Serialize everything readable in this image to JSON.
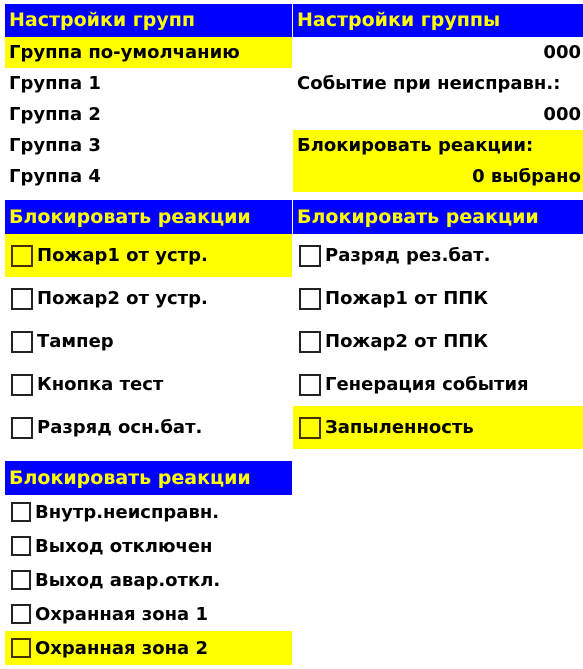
{
  "panels": {
    "group_settings": {
      "title": "Настройки групп",
      "items": [
        {
          "label": "Группа по-умолчанию",
          "selected": true
        },
        {
          "label": "Группа 1",
          "selected": false
        },
        {
          "label": "Группа 2",
          "selected": false
        },
        {
          "label": "Группа 3",
          "selected": false
        },
        {
          "label": "Группа 4",
          "selected": false
        }
      ]
    },
    "group_config": {
      "title": "Настройки группы",
      "rows": [
        {
          "text": "000",
          "align": "right",
          "selected": false
        },
        {
          "text": "Событие при неисправн.:",
          "align": "left",
          "selected": false
        },
        {
          "text": "000",
          "align": "right",
          "selected": false
        },
        {
          "text": "Блокировать реакции:",
          "align": "left",
          "selected": true
        },
        {
          "text": "0 выбрано",
          "align": "right",
          "selected": true
        }
      ]
    },
    "block_reactions_1": {
      "title": "Блокировать реакции",
      "items": [
        {
          "label": "Пожар1 от устр.",
          "checked": false,
          "selected": true
        },
        {
          "label": "Пожар2 от устр.",
          "checked": false,
          "selected": false
        },
        {
          "label": "Тампер",
          "checked": false,
          "selected": false
        },
        {
          "label": "Кнопка тест",
          "checked": false,
          "selected": false
        },
        {
          "label": "Разряд осн.бат.",
          "checked": false,
          "selected": false
        }
      ]
    },
    "block_reactions_2": {
      "title": "Блокировать реакции",
      "items": [
        {
          "label": "Разряд рез.бат.",
          "checked": false,
          "selected": false
        },
        {
          "label": "Пожар1 от ППК",
          "checked": false,
          "selected": false
        },
        {
          "label": "Пожар2 от ППК",
          "checked": false,
          "selected": false
        },
        {
          "label": "Генерация события",
          "checked": false,
          "selected": false
        },
        {
          "label": "Запыленность",
          "checked": false,
          "selected": true
        }
      ]
    },
    "block_reactions_3": {
      "title": "Блокировать реакции",
      "items": [
        {
          "label": "Внутр.неисправн.",
          "checked": false,
          "selected": false
        },
        {
          "label": "Выход отключен",
          "checked": false,
          "selected": false
        },
        {
          "label": "Выход авар.откл.",
          "checked": false,
          "selected": false
        },
        {
          "label": "Охранная зона 1",
          "checked": false,
          "selected": false
        },
        {
          "label": "Охранная зона 2",
          "checked": false,
          "selected": true
        }
      ]
    }
  },
  "colors": {
    "title_bg": "#0000ff",
    "title_fg": "#ffff00",
    "selection_bg": "#ffff00",
    "item_fg": "#000000"
  }
}
